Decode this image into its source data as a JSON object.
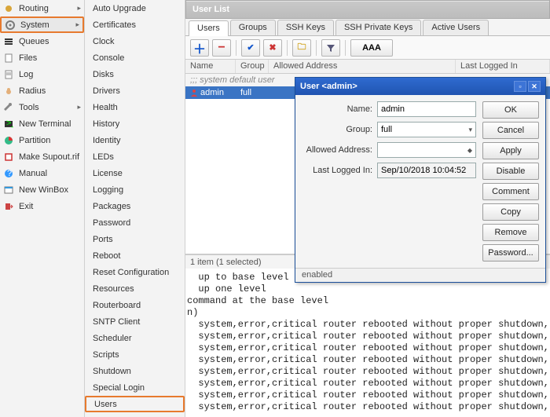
{
  "sidebar": [
    {
      "label": "Routing",
      "icon": "burst",
      "arrow": true
    },
    {
      "label": "System",
      "icon": "gear",
      "arrow": true,
      "highlight": true
    },
    {
      "label": "Queues",
      "icon": "queue"
    },
    {
      "label": "Files",
      "icon": "file"
    },
    {
      "label": "Log",
      "icon": "log"
    },
    {
      "label": "Radius",
      "icon": "radius"
    },
    {
      "label": "Tools",
      "icon": "wrench",
      "arrow": true
    },
    {
      "label": "New Terminal",
      "icon": "terminal"
    },
    {
      "label": "Partition",
      "icon": "pie"
    },
    {
      "label": "Make Supout.rif",
      "icon": "supout"
    },
    {
      "label": "Manual",
      "icon": "manual"
    },
    {
      "label": "New WinBox",
      "icon": "winbox"
    },
    {
      "label": "Exit",
      "icon": "exit"
    }
  ],
  "submenu": [
    "Auto Upgrade",
    "Certificates",
    "Clock",
    "Console",
    "Disks",
    "Drivers",
    "Health",
    "History",
    "Identity",
    "LEDs",
    "License",
    "Logging",
    "Packages",
    "Password",
    "Ports",
    "Reboot",
    "Reset Configuration",
    "Resources",
    "Routerboard",
    "SNTP Client",
    "Scheduler",
    "Scripts",
    "Shutdown",
    "Special Login",
    "Users"
  ],
  "userlist": {
    "title": "User List",
    "tabs": [
      "Users",
      "Groups",
      "SSH Keys",
      "SSH Private Keys",
      "Active Users"
    ],
    "activeTab": 0,
    "toolbar": {
      "aaa": "AAA"
    },
    "columns": [
      "Name",
      "Group",
      "Allowed Address",
      "Last Logged In"
    ],
    "commentRow": ";;; system default user",
    "rows": [
      {
        "name": "admin",
        "group": "full"
      }
    ],
    "status": "1 item (1 selected)"
  },
  "userdlg": {
    "title": "User <admin>",
    "fields": {
      "name_label": "Name:",
      "name": "admin",
      "group_label": "Group:",
      "group": "full",
      "addr_label": "Allowed Address:",
      "addr": "",
      "last_label": "Last Logged In:",
      "last": "Sep/10/2018 10:04:52"
    },
    "buttons": [
      "OK",
      "Cancel",
      "Apply",
      "Disable",
      "Comment",
      "Copy",
      "Remove",
      "Password..."
    ],
    "enabled": "enabled"
  },
  "log_text": "  up to base level\n  up one level\ncommand at the base level\nn)\n  system,error,critical router rebooted without proper shutdown, prob\n  system,error,critical router rebooted without proper shutdown, prob\n  system,error,critical router rebooted without proper shutdown, prob\n  system,error,critical router rebooted without proper shutdown, prob\n  system,error,critical router rebooted without proper shutdown, prob\n  system,error,critical router rebooted without proper shutdown, prob\n  system,error,critical router rebooted without proper shutdown, prob\n  system,error,critical router rebooted without proper shutdown, prob"
}
